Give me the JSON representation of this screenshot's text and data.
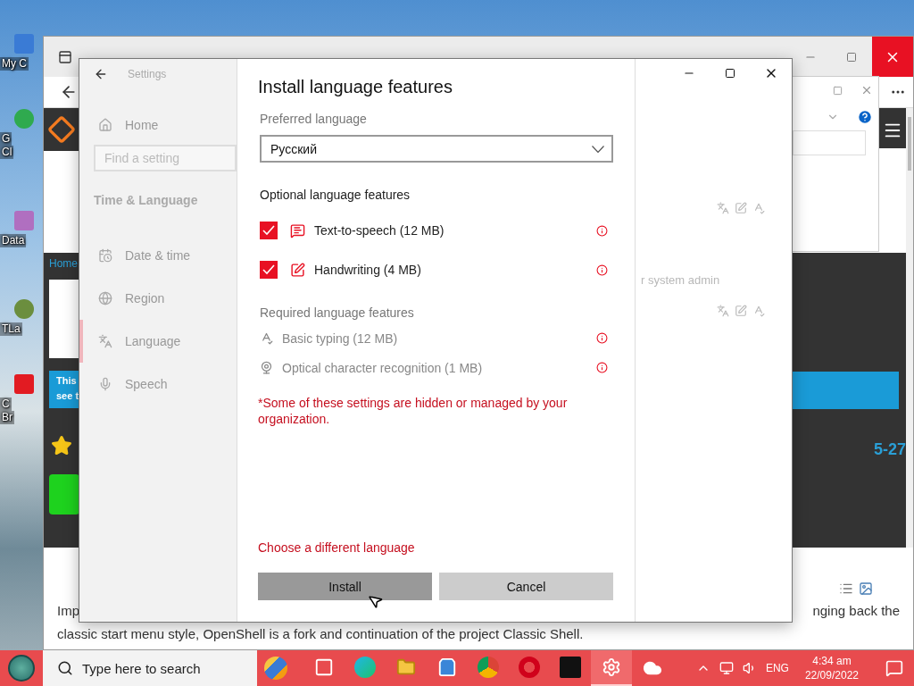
{
  "desktop": {
    "icons": [
      {
        "lines": [
          "My C"
        ]
      },
      {
        "lines": [
          "G",
          "Cl"
        ]
      },
      {
        "lines": [
          "Data"
        ]
      },
      {
        "lines": [
          "TLa"
        ]
      },
      {
        "lines": [
          "C",
          "Br"
        ]
      }
    ]
  },
  "browser": {
    "page": {
      "nav_link": "Home",
      "banner_lines": [
        "This",
        "see t"
      ],
      "side_text": "5-27"
    },
    "article": {
      "line_1_start": "Imp",
      "line_1_end": "nging back the",
      "line_2": "classic start menu style, OpenShell is a fork and continuation of the project Classic Shell."
    }
  },
  "settings": {
    "title": "Settings",
    "home": "Home",
    "search": {
      "placeholder": "Find a setting"
    },
    "section": "Time & Language",
    "nav": [
      {
        "label": "Date & time",
        "selected": false
      },
      {
        "label": "Region",
        "selected": false
      },
      {
        "label": "Language",
        "selected": true
      },
      {
        "label": "Speech",
        "selected": false
      }
    ],
    "faded_text": "r system admin"
  },
  "dialog": {
    "title": "Install language features",
    "preferred_label": "Preferred language",
    "dropdown": {
      "value": "Русский"
    },
    "optional_heading": "Optional language features",
    "optional": [
      {
        "label": "Text-to-speech (12 MB)",
        "checked": true
      },
      {
        "label": "Handwriting (4 MB)",
        "checked": true
      }
    ],
    "required_heading": "Required language features",
    "required": [
      {
        "label": "Basic typing (12 MB)"
      },
      {
        "label": "Optical character recognition (1 MB)"
      }
    ],
    "note": "*Some of these settings are hidden or managed by your organization.",
    "link": "Choose a different language",
    "buttons": [
      {
        "label": "Install",
        "kind": "primary"
      },
      {
        "label": "Cancel",
        "kind": "secondary"
      }
    ]
  },
  "taskbar": {
    "search": {
      "placeholder": "Type here to search"
    },
    "apps": [
      {
        "selected": false
      },
      {
        "selected": false
      },
      {
        "selected": false
      },
      {
        "selected": false
      },
      {
        "selected": false
      },
      {
        "selected": false
      },
      {
        "selected": false
      },
      {
        "selected": true
      }
    ],
    "language": "ENG",
    "time": "4:34 am",
    "date": "22/09/2022"
  }
}
